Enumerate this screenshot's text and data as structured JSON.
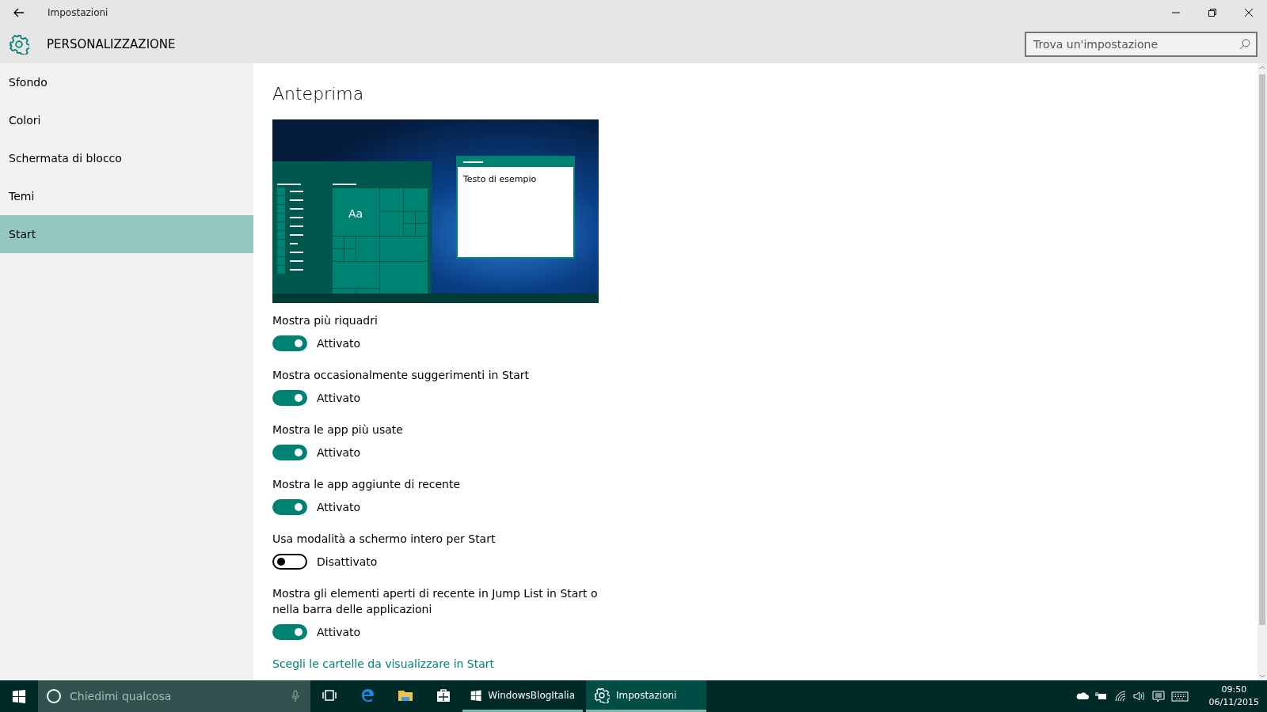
{
  "window": {
    "title": "Impostazioni"
  },
  "header": {
    "title": "PERSONALIZZAZIONE",
    "search": {
      "placeholder": "Trova un'impostazione"
    }
  },
  "sidebar": {
    "items": [
      {
        "label": "Sfondo",
        "selected": false
      },
      {
        "label": "Colori",
        "selected": false
      },
      {
        "label": "Schermata di blocco",
        "selected": false
      },
      {
        "label": "Temi",
        "selected": false
      },
      {
        "label": "Start",
        "selected": true
      }
    ]
  },
  "content": {
    "title": "Anteprima",
    "preview": {
      "tile_text": "Aa",
      "window_text": "Testo di esempio"
    },
    "settings": [
      {
        "label": "Mostra più riquadri",
        "on": true,
        "state": "Attivato"
      },
      {
        "label": "Mostra occasionalmente suggerimenti in Start",
        "on": true,
        "state": "Attivato"
      },
      {
        "label": "Mostra le app più usate",
        "on": true,
        "state": "Attivato"
      },
      {
        "label": "Mostra le app aggiunte di recente",
        "on": true,
        "state": "Attivato"
      },
      {
        "label": "Usa modalità a schermo intero per Start",
        "on": false,
        "state": "Disattivato"
      },
      {
        "label": "Mostra gli elementi aperti di recente in Jump List in Start o nella barra delle applicazioni",
        "on": true,
        "state": "Attivato"
      }
    ],
    "link": "Scegli le cartelle da visualizzare in Start"
  },
  "taskbar": {
    "search": {
      "placeholder": "Chiedimi qualcosa"
    },
    "apps": [
      {
        "kind": "taskview"
      },
      {
        "kind": "edge"
      },
      {
        "kind": "explorer"
      },
      {
        "kind": "store"
      },
      {
        "kind": "window",
        "label": "WindowsBlogItalia",
        "selected": false
      },
      {
        "kind": "settings",
        "label": "Impostazioni",
        "selected": true
      }
    ],
    "clock": {
      "time": "09:50",
      "date": "06/11/2015"
    }
  }
}
